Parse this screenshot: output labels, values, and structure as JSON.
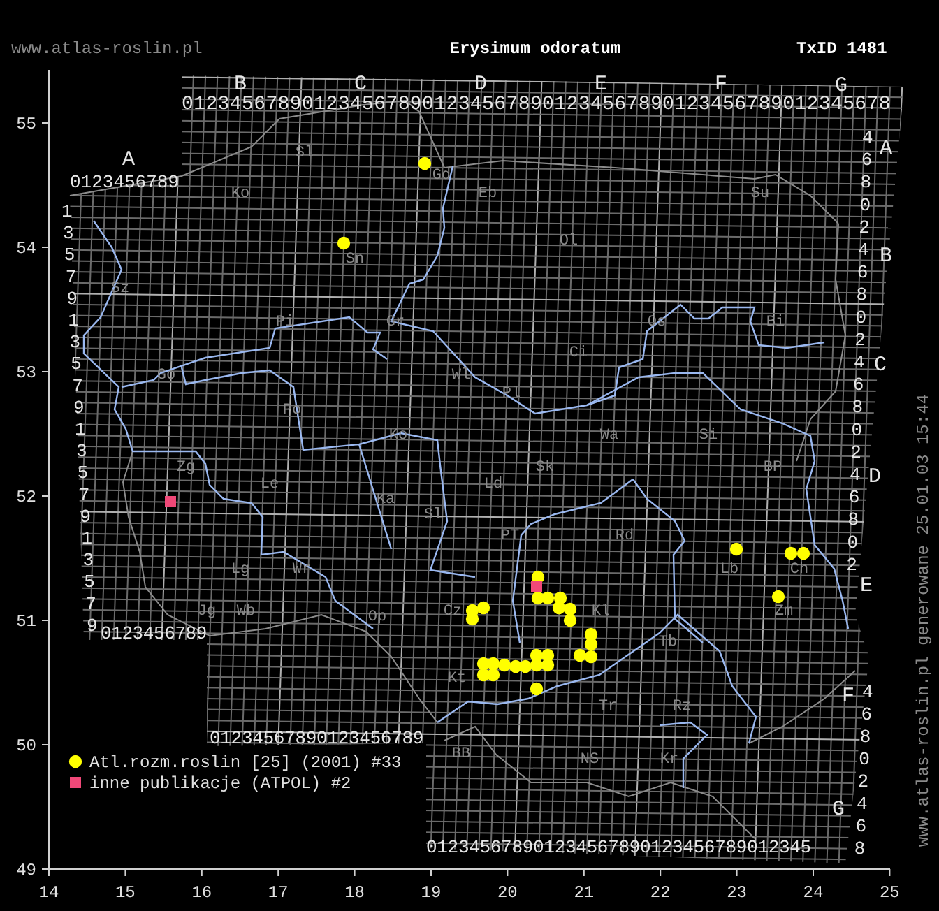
{
  "header": {
    "site": "www.atlas-roslin.pl",
    "title": "Erysimum odoratum",
    "taxon_id": "TxID 1481"
  },
  "map": {
    "top_letters": [
      "B",
      "C",
      "D",
      "E",
      "F",
      "G"
    ],
    "left_letter": "A",
    "top_index_row": "01234567890123456789012345678901234567890123456789012345678",
    "left_top_index_row": "0123456789",
    "left_index_column": [
      "1",
      "3",
      "5",
      "7",
      "9",
      "1",
      "3",
      "5",
      "7",
      "9",
      "1",
      "3",
      "5",
      "7",
      "9",
      "1",
      "3",
      "5",
      "7",
      "9"
    ],
    "left_bottom_index_row": "0123456789",
    "right_letters": [
      "A",
      "B",
      "C",
      "D",
      "E",
      "F",
      "G"
    ],
    "right_index_column": [
      "4",
      "6",
      "8",
      "0",
      "2",
      "4",
      "6",
      "8",
      "0",
      "2",
      "4",
      "6",
      "8",
      "0",
      "2",
      "4",
      "6",
      "8",
      "0",
      "2"
    ],
    "right_lower_index_column": [
      "4",
      "6",
      "8",
      "0",
      "2",
      "4",
      "6",
      "8"
    ],
    "bottom_index_rows": [
      "01234567890123456789",
      "012345678901234567890123456789012345"
    ],
    "place_labels": [
      "Sl",
      "Gd",
      "Ko",
      "Eb",
      "Su",
      "Ol",
      "Sn",
      "Sz",
      "Pi",
      "Gr",
      "Os",
      "Bi",
      "Ci",
      "Go",
      "Wl",
      "Pl",
      "Po",
      "Ko",
      "Wa",
      "Si",
      "Zg",
      "Sk",
      "BP",
      "Le",
      "Ld",
      "Ka",
      "Sl",
      "PT",
      "Rd",
      "Lg",
      "Wr",
      "Lb",
      "Ch",
      "Jg",
      "Wb",
      "Cz",
      "Kl",
      "Zm",
      "Op",
      "Tb",
      "Kt",
      "Tr",
      "Rz",
      "BB",
      "NS",
      "Kr"
    ],
    "legend": [
      {
        "label": "Atl.rozm.roslin [25] (2001) #33",
        "color": "#ffff00",
        "kind": "circle"
      },
      {
        "label": "inne publikacje (ATPOL) #2",
        "color": "#f04878",
        "kind": "square"
      }
    ],
    "y_axis_labels": [
      "55",
      "54",
      "53",
      "52",
      "51",
      "50",
      "49"
    ],
    "x_axis_labels": [
      "14",
      "15",
      "16",
      "17",
      "18",
      "19",
      "20",
      "21",
      "22",
      "23",
      "24",
      "25"
    ]
  },
  "footer_note": "www.atlas-roslin.pl generowane 25.01.03 15:44"
}
